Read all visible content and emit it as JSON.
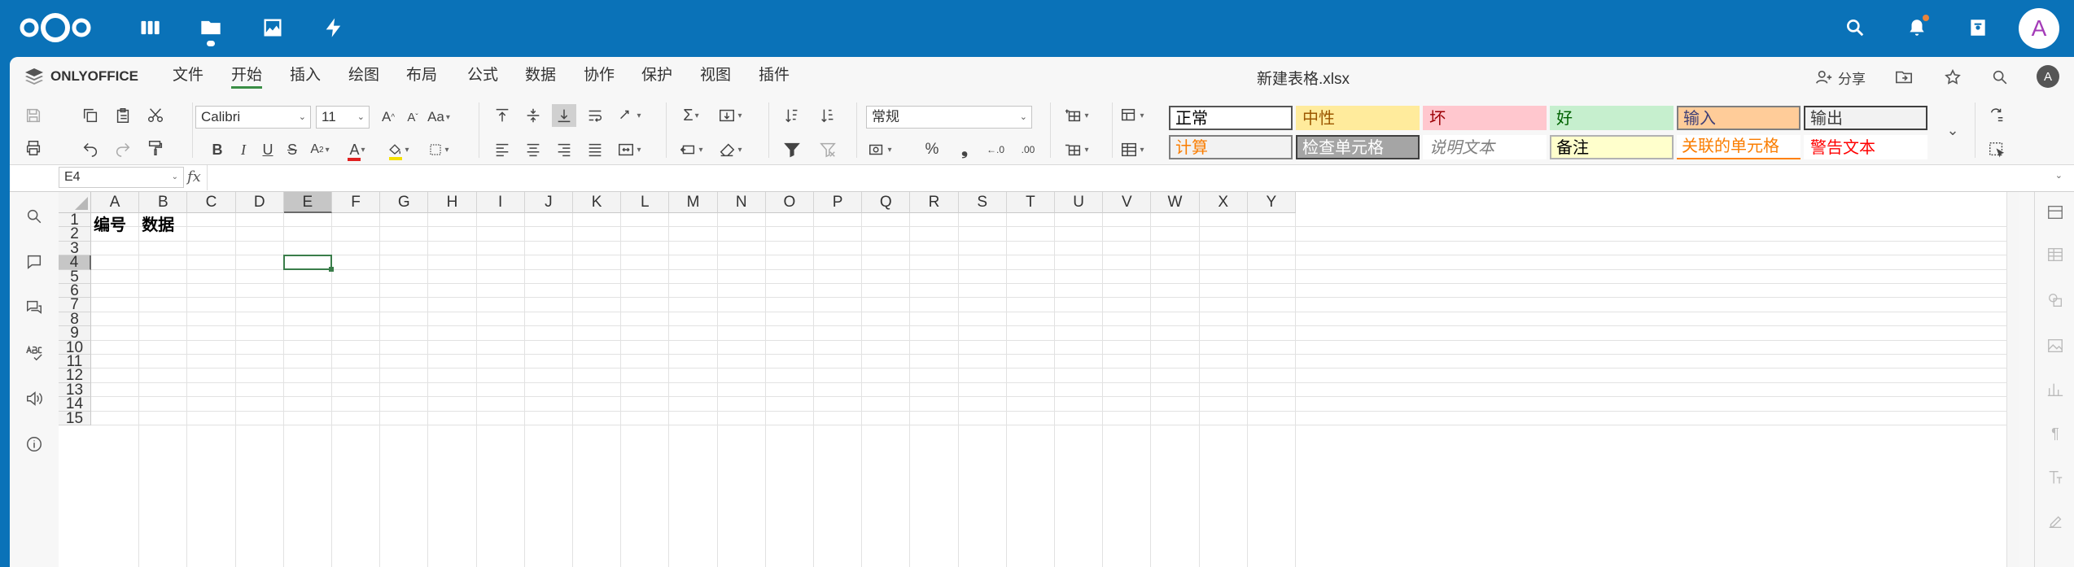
{
  "nextcloud": {
    "apps": [
      "dashboard-icon",
      "files-icon",
      "photos-icon",
      "activity-icon"
    ],
    "right_icons": [
      "search-icon",
      "bell-icon",
      "contacts-icon"
    ],
    "avatar_letter": "A"
  },
  "editor": {
    "brand": "ONLYOFFICE",
    "menu": [
      "文件",
      "开始",
      "插入",
      "绘图",
      "布局",
      "公式",
      "数据",
      "协作",
      "保护",
      "视图",
      "插件"
    ],
    "active_menu": "开始",
    "doc_title": "新建表格.xlsx",
    "share_label": "分享",
    "user_avatar": "A"
  },
  "toolbar": {
    "font_name": "Calibri",
    "font_size": "11",
    "number_format": "常规",
    "font_color": "#e02020",
    "fill_color": "#f5e000"
  },
  "cell_styles": [
    {
      "label": "正常",
      "bg": "#ffffff",
      "color": "#000000",
      "border": "#555555"
    },
    {
      "label": "中性",
      "bg": "#ffeb9c",
      "color": "#9c5700",
      "border": "#ffeb9c"
    },
    {
      "label": "坏",
      "bg": "#ffc7ce",
      "color": "#9c0006",
      "border": "#ffc7ce"
    },
    {
      "label": "好",
      "bg": "#c6efce",
      "color": "#006100",
      "border": "#c6efce"
    },
    {
      "label": "输入",
      "bg": "#ffcc99",
      "color": "#3f3f76",
      "border": "#7f7f7f"
    },
    {
      "label": "输出",
      "bg": "#f2f2f2",
      "color": "#3f3f3f",
      "border": "#3f3f3f"
    },
    {
      "label": "计算",
      "bg": "#f2f2f2",
      "color": "#fa7d00",
      "border": "#7f7f7f"
    },
    {
      "label": "检查单元格",
      "bg": "#a5a5a5",
      "color": "#ffffff",
      "border": "#3f3f3f"
    },
    {
      "label": "说明文本",
      "bg": "#ffffff",
      "color": "#7f7f7f",
      "border": "#ffffff"
    },
    {
      "label": "备注",
      "bg": "#ffffcc",
      "color": "#000000",
      "border": "#b2b2b2"
    },
    {
      "label": "关联的单元格",
      "bg": "#ffffff",
      "color": "#fa7d00",
      "border": "#ff8001"
    },
    {
      "label": "警告文本",
      "bg": "#ffffff",
      "color": "#ff0000",
      "border": "#ffffff"
    }
  ],
  "formula_bar": {
    "name_box": "E4",
    "fx_label": "fx",
    "formula": ""
  },
  "grid": {
    "columns": [
      "A",
      "B",
      "C",
      "D",
      "E",
      "F",
      "G",
      "H",
      "I",
      "J",
      "K",
      "L",
      "M",
      "N",
      "O",
      "P",
      "Q",
      "R",
      "S",
      "T",
      "U",
      "V",
      "W",
      "X",
      "Y"
    ],
    "rows": [
      "1",
      "2",
      "3",
      "4",
      "5",
      "6",
      "7",
      "8",
      "9",
      "10",
      "11",
      "12",
      "13",
      "14",
      "15"
    ],
    "selected_column": "E",
    "selected_row": "4",
    "cells": {
      "A1": "编号",
      "B1": "数据"
    }
  }
}
